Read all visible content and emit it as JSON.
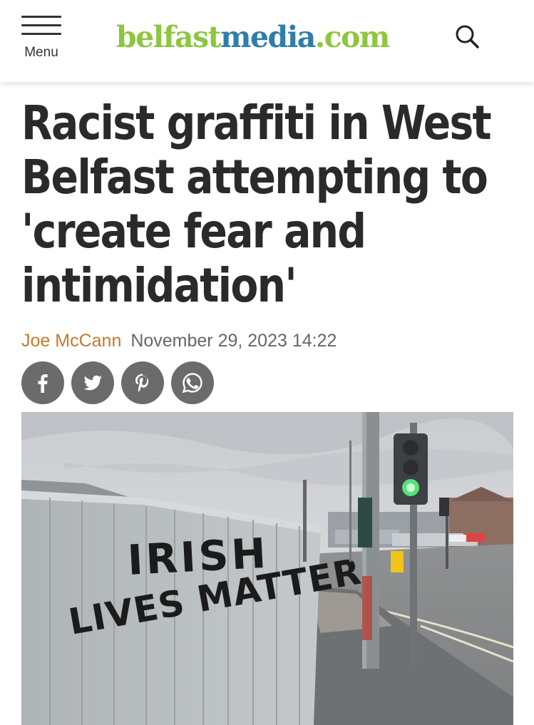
{
  "header": {
    "menu_label": "Menu",
    "logo": {
      "part1": "belfast",
      "part2": "media",
      "part3": ".com"
    },
    "colors": {
      "logo_green": "#8dc63f",
      "logo_blue": "#2e7ea8"
    }
  },
  "article": {
    "headline": "Racist graffiti in West Belfast attempting to 'create fear and intimidation'",
    "author": "Joe McCann",
    "date": "November 29, 2023 14:22",
    "author_color": "#c6792d"
  },
  "share": [
    {
      "network": "facebook",
      "icon": "facebook-icon"
    },
    {
      "network": "twitter",
      "icon": "twitter-icon"
    },
    {
      "network": "pinterest",
      "icon": "pinterest-icon"
    },
    {
      "network": "whatsapp",
      "icon": "whatsapp-icon"
    }
  ],
  "photo": {
    "graffiti_line1": "IRISH",
    "graffiti_line2": "LIVES MATTER!"
  }
}
